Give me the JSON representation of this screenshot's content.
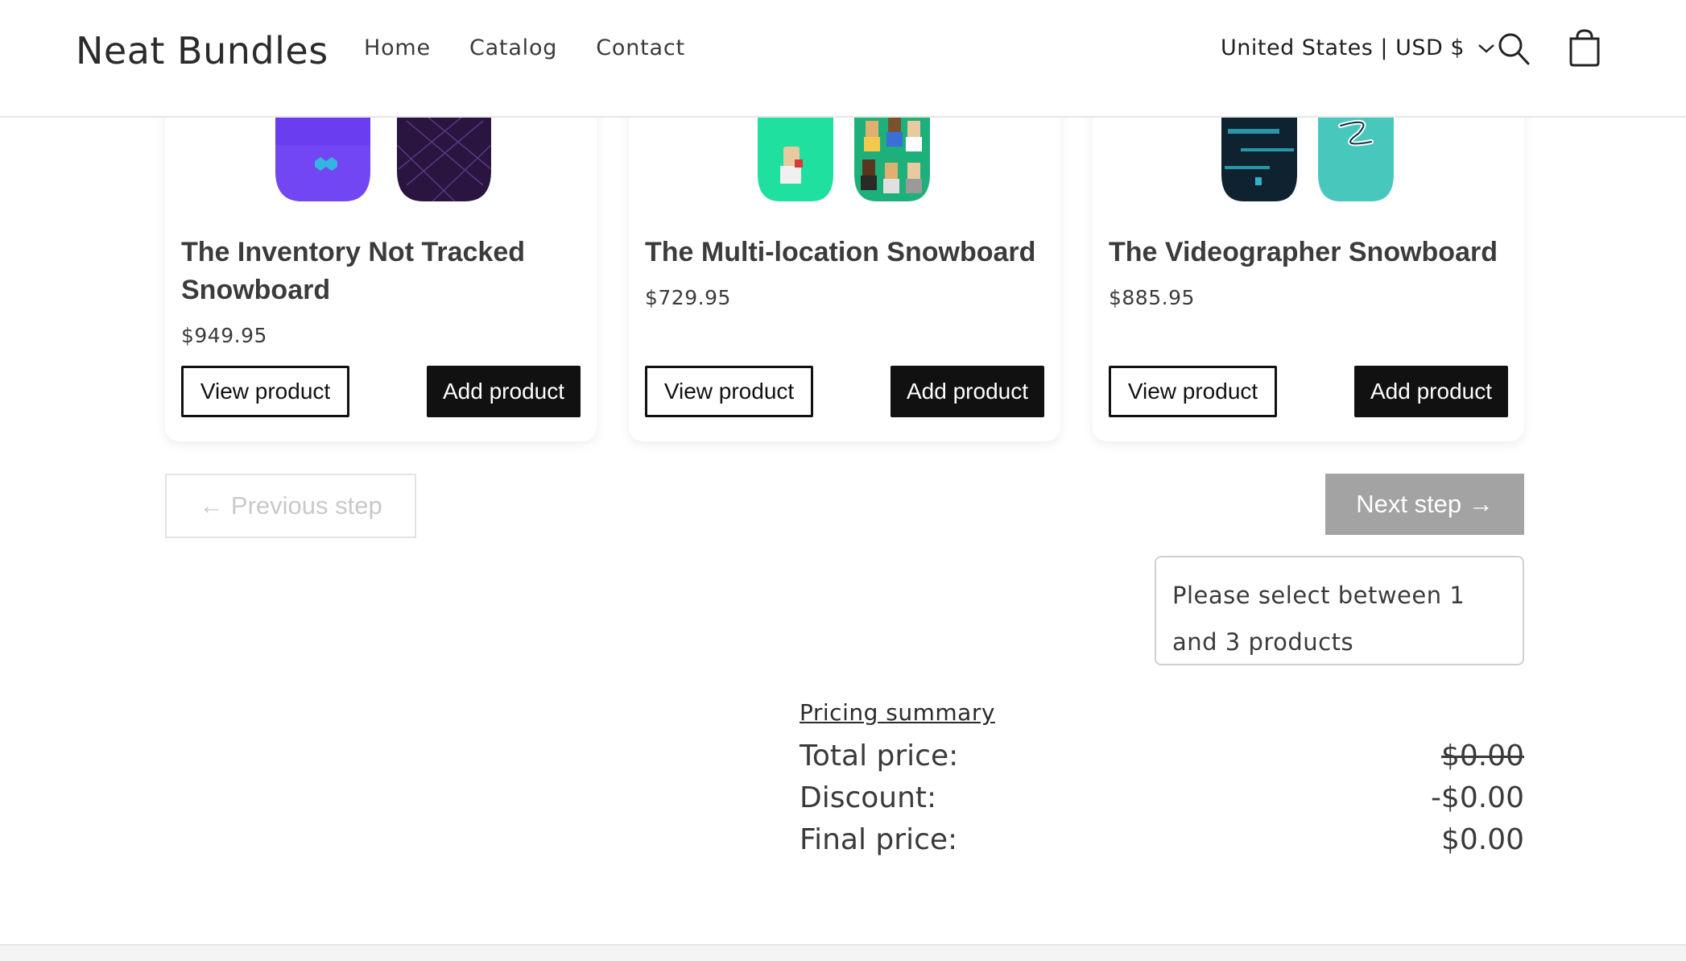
{
  "header": {
    "logo": "Neat Bundles",
    "nav": [
      "Home",
      "Catalog",
      "Contact"
    ],
    "locale": "United States | USD $"
  },
  "products": [
    {
      "title": "The Inventory Not Tracked Snowboard",
      "price": "$949.95",
      "view_label": "View product",
      "add_label": "Add product",
      "colors": [
        "#6a3df0",
        "#2a1440"
      ]
    },
    {
      "title": "The Multi-location Snowboard",
      "price": "$729.95",
      "view_label": "View product",
      "add_label": "Add product",
      "colors": [
        "#20e0a0",
        "#1db07a"
      ]
    },
    {
      "title": "The Videographer Snowboard",
      "price": "$885.95",
      "view_label": "View product",
      "add_label": "Add product",
      "colors": [
        "#0f2230",
        "#48c8bc"
      ]
    }
  ],
  "steps": {
    "prev_label": "← Previous step",
    "next_label": "Next step →",
    "notice": "Please select between 1 and 3 products"
  },
  "pricing": {
    "title": "Pricing summary",
    "total_label": "Total price:",
    "total_value": "$0.00",
    "discount_label": "Discount:",
    "discount_value": "-$0.00",
    "final_label": "Final price:",
    "final_value": "$0.00"
  }
}
